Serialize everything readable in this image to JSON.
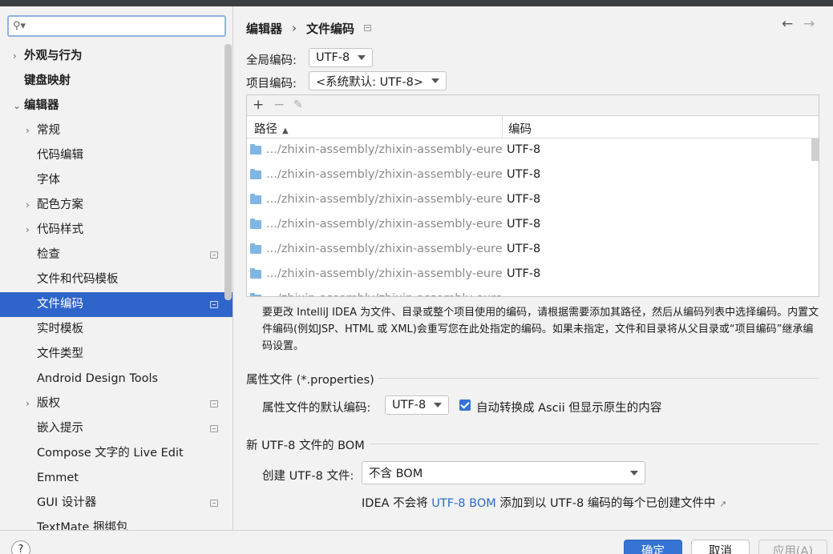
{
  "search": {
    "placeholder": "",
    "icon": "search-icon"
  },
  "sidebar": {
    "items": [
      {
        "label": "外观与行为",
        "arrow": "›"
      },
      {
        "label": "键盘映射",
        "arrow": ""
      },
      {
        "label": "编辑器",
        "arrow": "⌄"
      },
      {
        "label": "常规",
        "arrow": "›"
      },
      {
        "label": "代码编辑",
        "arrow": ""
      },
      {
        "label": "字体",
        "arrow": ""
      },
      {
        "label": "配色方案",
        "arrow": "›"
      },
      {
        "label": "代码样式",
        "arrow": "›"
      },
      {
        "label": "检查",
        "arrow": ""
      },
      {
        "label": "文件和代码模板",
        "arrow": ""
      },
      {
        "label": "文件编码",
        "arrow": ""
      },
      {
        "label": "实时模板",
        "arrow": ""
      },
      {
        "label": "文件类型",
        "arrow": ""
      },
      {
        "label": "Android Design Tools",
        "arrow": ""
      },
      {
        "label": "版权",
        "arrow": "›"
      },
      {
        "label": "嵌入提示",
        "arrow": ""
      },
      {
        "label": "Compose 文字的 Live Edit",
        "arrow": ""
      },
      {
        "label": "Emmet",
        "arrow": ""
      },
      {
        "label": "GUI 设计器",
        "arrow": ""
      },
      {
        "label": "TextMate 捆绑包",
        "arrow": ""
      }
    ]
  },
  "header": {
    "breadcrumb_parent": "编辑器",
    "breadcrumb_sep": "›",
    "breadcrumb_current": "文件编码",
    "back": "←",
    "forward": "→"
  },
  "encoding": {
    "global_label": "全局编码:",
    "global_value": "UTF-8",
    "project_label": "项目编码:",
    "project_value": "<系统默认: UTF-8>"
  },
  "table": {
    "toolbar": {
      "add": "+",
      "remove": "−",
      "edit": "✎"
    },
    "col_path": "路径",
    "sort_icon": "▲",
    "col_encoding": "编码",
    "rows": [
      {
        "path": ".../zhixin-assembly/zhixin-assembly-eureka",
        "encoding": "UTF-8"
      },
      {
        "path": ".../zhixin-assembly/zhixin-assembly-eureka",
        "encoding": "UTF-8"
      },
      {
        "path": ".../zhixin-assembly/zhixin-assembly-eureka",
        "encoding": "UTF-8"
      },
      {
        "path": ".../zhixin-assembly/zhixin-assembly-eureka",
        "encoding": "UTF-8"
      },
      {
        "path": ".../zhixin-assembly/zhixin-assembly-eureka",
        "encoding": "UTF-8"
      },
      {
        "path": ".../zhixin-assembly/zhixin-assembly-eureka",
        "encoding": "UTF-8"
      },
      {
        "path": ".../zhixin-assembly/zhixin-assembly-eureka",
        "encoding": ""
      }
    ]
  },
  "description": "要更改 IntelliJ IDEA 为文件、目录或整个项目使用的编码，请根据需要添加其路径，然后从编码列表中选择编码。内置文件编码(例如JSP、HTML 或 XML)会重写您在此处指定的编码。如果未指定，文件和目录将从父目录或“项目编码”继承编码设置。",
  "properties": {
    "section_title": "属性文件 (*.properties)",
    "default_label": "属性文件的默认编码:",
    "default_value": "UTF-8",
    "ascii_checkbox_label": "自动转换成 Ascii 但显示原生的内容",
    "ascii_checked": true
  },
  "bom": {
    "section_title": "新 UTF-8 文件的 BOM",
    "create_label": "创建 UTF-8 文件:",
    "create_value": "不含 BOM",
    "note_prefix": "IDEA 不会将",
    "note_link": "UTF-8 BOM",
    "note_suffix": "添加到以 UTF-8 编码的每个已创建文件中",
    "note_ext_icon": "↗"
  },
  "footer": {
    "help": "?",
    "ok": "确定",
    "cancel": "取消",
    "apply": "应用(A)"
  },
  "colors": {
    "accent": "#2f65ca",
    "link": "#2a6ac8",
    "folder": "#7fb6e4"
  }
}
